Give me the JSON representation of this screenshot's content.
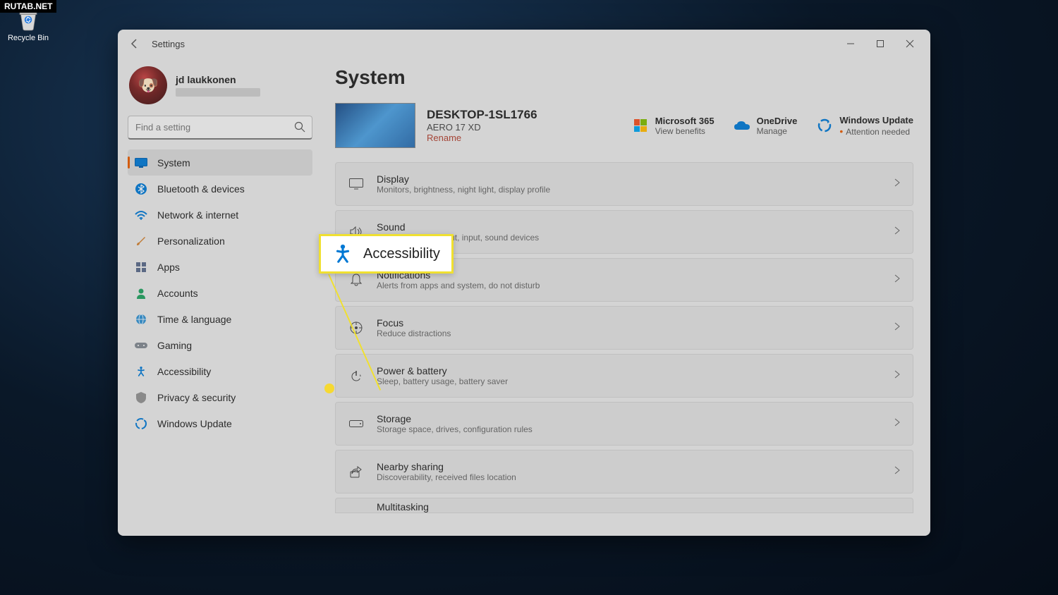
{
  "watermark": "RUTAB.NET",
  "desktop": {
    "recycle_bin": "Recycle Bin"
  },
  "window": {
    "app_title": "Settings"
  },
  "user": {
    "name": "jd laukkonen"
  },
  "search": {
    "placeholder": "Find a setting"
  },
  "sidebar": {
    "items": [
      {
        "label": "System",
        "icon": "system"
      },
      {
        "label": "Bluetooth & devices",
        "icon": "bluetooth"
      },
      {
        "label": "Network & internet",
        "icon": "wifi"
      },
      {
        "label": "Personalization",
        "icon": "brush"
      },
      {
        "label": "Apps",
        "icon": "apps"
      },
      {
        "label": "Accounts",
        "icon": "person"
      },
      {
        "label": "Time & language",
        "icon": "globe"
      },
      {
        "label": "Gaming",
        "icon": "gamepad"
      },
      {
        "label": "Accessibility",
        "icon": "accessibility"
      },
      {
        "label": "Privacy & security",
        "icon": "shield"
      },
      {
        "label": "Windows Update",
        "icon": "update"
      }
    ]
  },
  "page": {
    "title": "System"
  },
  "pc": {
    "name": "DESKTOP-1SL1766",
    "model": "AERO 17 XD",
    "rename": "Rename"
  },
  "quick": {
    "m365": {
      "title": "Microsoft 365",
      "sub": "View benefits"
    },
    "onedrive": {
      "title": "OneDrive",
      "sub": "Manage"
    },
    "update": {
      "title": "Windows Update",
      "sub": "Attention needed"
    }
  },
  "settings": [
    {
      "title": "Display",
      "sub": "Monitors, brightness, night light, display profile",
      "icon": "display"
    },
    {
      "title": "Sound",
      "sub": "Volume levels, output, input, sound devices",
      "icon": "sound"
    },
    {
      "title": "Notifications",
      "sub": "Alerts from apps and system, do not disturb",
      "icon": "bell"
    },
    {
      "title": "Focus",
      "sub": "Reduce distractions",
      "icon": "focus"
    },
    {
      "title": "Power & battery",
      "sub": "Sleep, battery usage, battery saver",
      "icon": "power"
    },
    {
      "title": "Storage",
      "sub": "Storage space, drives, configuration rules",
      "icon": "storage"
    },
    {
      "title": "Nearby sharing",
      "sub": "Discoverability, received files location",
      "icon": "share"
    }
  ],
  "partial_row": "Multitasking",
  "callout": {
    "label": "Accessibility"
  }
}
